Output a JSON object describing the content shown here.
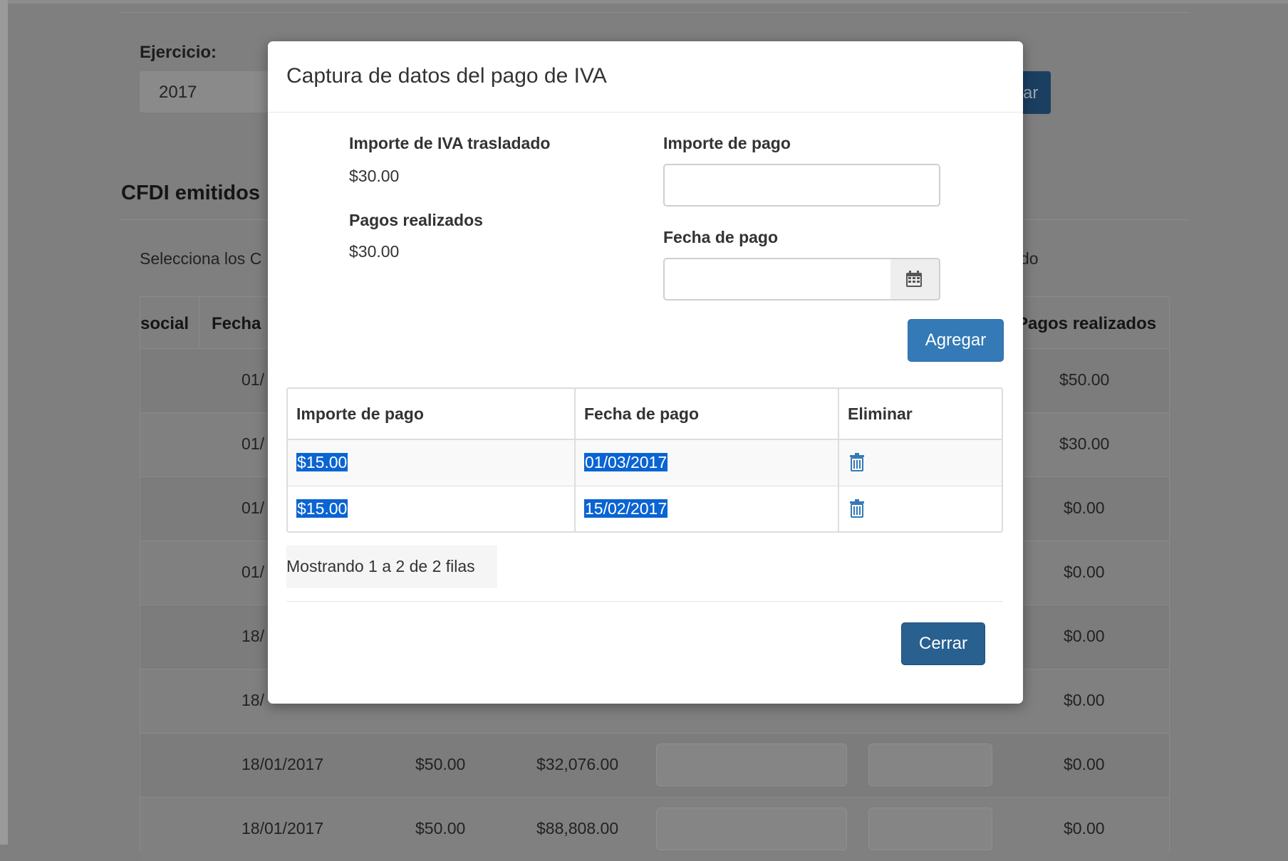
{
  "background": {
    "ejercicio_label": "Ejercicio:",
    "ejercicio_value": "2017",
    "button_partial": "ar",
    "section_title": "CFDI emitidos",
    "instructions_left": "Selecciona los C",
    "instructions_right": "do",
    "table": {
      "headers": [
        "social",
        "Fecha",
        "Pagos realizados"
      ],
      "rows": [
        {
          "fecha": "01/",
          "monto": "",
          "total": "",
          "pagos": "$50.00"
        },
        {
          "fecha": "01/",
          "monto": "",
          "total": "",
          "pagos": "$30.00"
        },
        {
          "fecha": "01/",
          "monto": "",
          "total": "",
          "pagos": "$0.00"
        },
        {
          "fecha": "01/",
          "monto": "",
          "total": "",
          "pagos": "$0.00"
        },
        {
          "fecha": "18/",
          "monto": "",
          "total": "",
          "pagos": "$0.00"
        },
        {
          "fecha": "18/",
          "monto": "",
          "total": "",
          "pagos": "$0.00"
        },
        {
          "fecha": "18/01/2017",
          "monto": "$50.00",
          "total": "$32,076.00",
          "pagos": "$0.00"
        },
        {
          "fecha": "18/01/2017",
          "monto": "$50.00",
          "total": "$88,808.00",
          "pagos": "$0.00"
        }
      ]
    }
  },
  "modal": {
    "title": "Captura de datos del pago de IVA",
    "iva_trasladado_label": "Importe de IVA trasladado",
    "iva_trasladado_value": "$30.00",
    "pagos_realizados_label": "Pagos realizados",
    "pagos_realizados_value": "$30.00",
    "importe_pago_label": "Importe de pago",
    "importe_pago_value": "",
    "fecha_pago_label": "Fecha de pago",
    "fecha_pago_value": "",
    "calendar_icon": "calendar-icon",
    "agregar_label": "Agregar",
    "table": {
      "headers": [
        "Importe de pago",
        "Fecha de pago",
        "Eliminar"
      ],
      "rows": [
        {
          "importe": "$15.00",
          "fecha": "01/03/2017",
          "action_icon": "trash-icon"
        },
        {
          "importe": "$15.00",
          "fecha": "15/02/2017",
          "action_icon": "trash-icon"
        }
      ]
    },
    "pagination_info": "Mostrando 1 a 2 de 2 filas",
    "cerrar_label": "Cerrar"
  },
  "colors": {
    "primary": "#337ab7",
    "primary_dark": "#286090",
    "selection": "#0a64d2",
    "overlay": "#7f7f7f"
  }
}
